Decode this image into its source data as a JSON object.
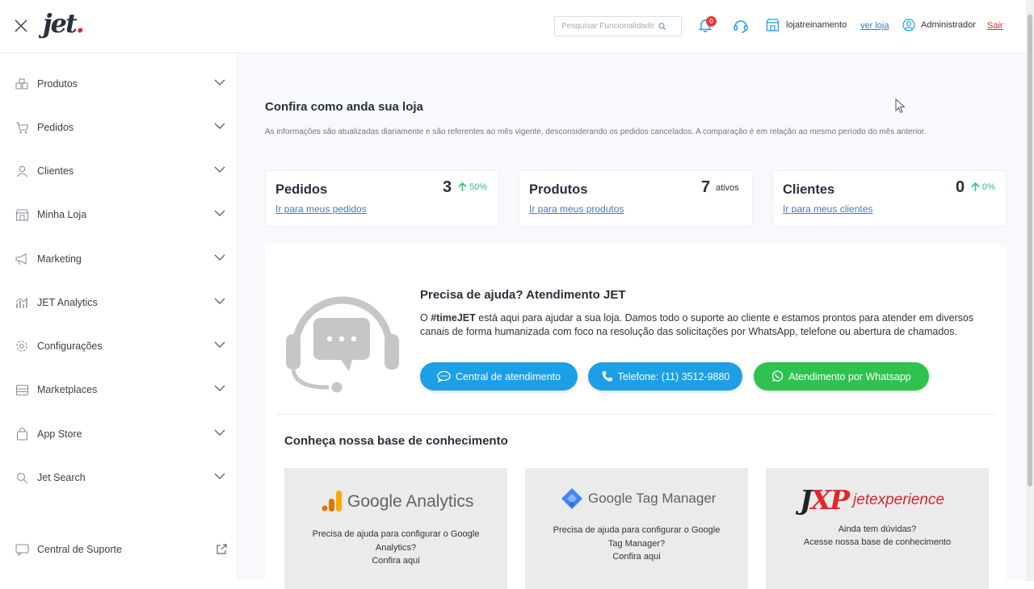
{
  "header": {
    "logo_text": "jet",
    "logo_dot": ".",
    "search_placeholder": "Pesquisar Funcionalidade",
    "notif_count": "0",
    "store_name": "lojatreinamento",
    "ver_loja": "ver loja",
    "user_name": "Administrador",
    "sair": "Sair"
  },
  "sidebar": {
    "items": [
      {
        "label": "Produtos",
        "icon": "boxes-icon"
      },
      {
        "label": "Pedidos",
        "icon": "cart-icon"
      },
      {
        "label": "Clientes",
        "icon": "user-icon"
      },
      {
        "label": "Minha Loja",
        "icon": "store-icon"
      },
      {
        "label": "Marketing",
        "icon": "megaphone-icon"
      },
      {
        "label": "JET Analytics",
        "icon": "chart-icon"
      },
      {
        "label": "Configurações",
        "icon": "gear-icon"
      },
      {
        "label": "Marketplaces",
        "icon": "marketplace-icon"
      },
      {
        "label": "App Store",
        "icon": "bag-icon"
      },
      {
        "label": "Jet Search",
        "icon": "search-icon"
      }
    ],
    "support_label": "Central de Suporte"
  },
  "main": {
    "title": "Confira como anda sua loja",
    "description": "As informações são atualizadas diariamente e são referentes ao mês vigente, desconsiderando os pedidos cancelados. A comparação é em relação ao mesmo período do mês anterior.",
    "cards": [
      {
        "title": "Pedidos",
        "value": "3",
        "pct": "50%",
        "link": "Ir para meus pedidos"
      },
      {
        "title": "Produtos",
        "value": "7",
        "sub": "ativos",
        "link": "Ir para meus produtos"
      },
      {
        "title": "Clientes",
        "value": "0",
        "pct": "0%",
        "link": "Ir para meus clientes"
      }
    ],
    "help": {
      "title": "Precisa de ajuda? Atendimento JET",
      "text_bold": "#timeJET",
      "text_prefix": "O ",
      "text_rest": " está aqui para ajudar a sua loja. Damos todo o suporte ao cliente e estamos prontos para atender em diversos canais de forma humanizada com foco na resolução das solicitações por WhatsApp, telefone ou abertura de chamados.",
      "btn_central": "Central de atendimento",
      "btn_phone": "Telefone: (11) 3512-9880",
      "btn_whatsapp": "Atendimento por Whatsapp"
    },
    "kb": {
      "title": "Conheça nossa base de conhecimento",
      "cards": [
        {
          "logo": "Google Analytics",
          "text": "Precisa de ajuda para configurar o Google Analytics?",
          "cta": "Confira aqui"
        },
        {
          "logo": "Google Tag Manager",
          "text": "Precisa de ajuda para configurar o Google Tag Manager?",
          "cta": "Confira aqui"
        },
        {
          "logo_j": "J",
          "logo_xp": "XP",
          "logo_je": "jetexperience",
          "text": "Ainda tem dúvidas?",
          "cta": "Acesse nossa base de conhecimento"
        }
      ]
    }
  },
  "colors": {
    "accent_blue": "#1d9fe6",
    "whatsapp_green": "#2fc24e",
    "brand_red": "#e0282b",
    "positive": "#35c07a"
  }
}
